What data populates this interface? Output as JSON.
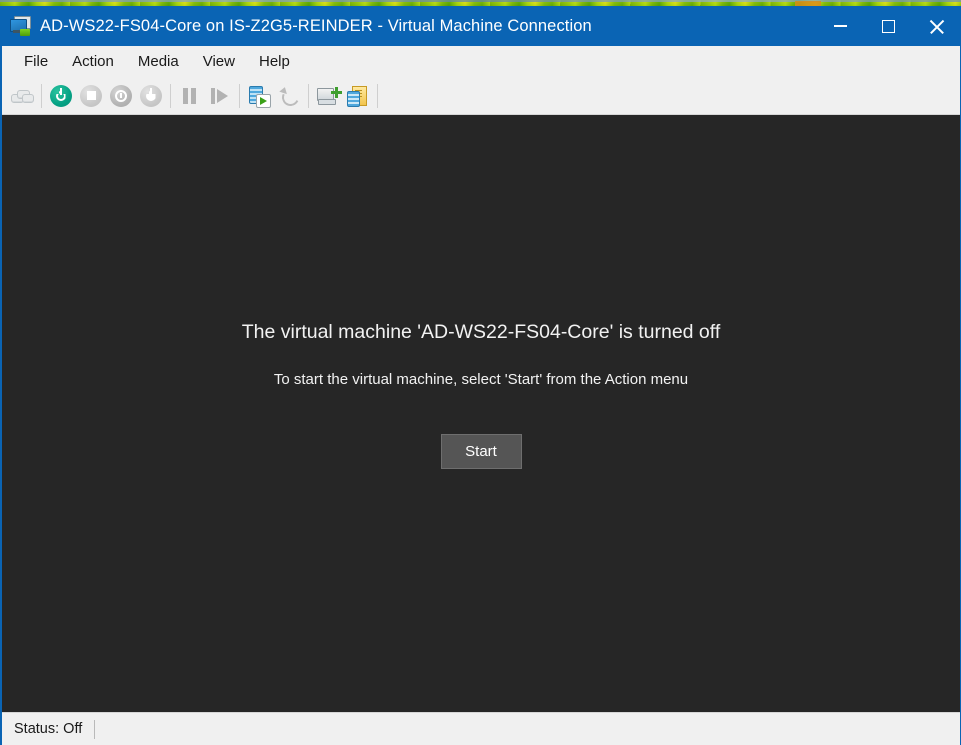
{
  "window": {
    "title": "AD-WS22-FS04-Core on IS-Z2G5-REINDER - Virtual Machine Connection",
    "icon": "virtual-machine-icon",
    "accent_color": "#0a64b4",
    "controls": {
      "minimize": "Minimize",
      "maximize": "Maximize",
      "close": "Close"
    }
  },
  "menubar": {
    "items": [
      {
        "label": "File"
      },
      {
        "label": "Action"
      },
      {
        "label": "Media"
      },
      {
        "label": "View"
      },
      {
        "label": "Help"
      }
    ]
  },
  "toolbar": {
    "buttons": [
      {
        "name": "ctrl-alt-delete-icon",
        "tooltip": "Ctrl+Alt+Delete",
        "enabled": false
      },
      {
        "name": "start-icon",
        "tooltip": "Start",
        "enabled": true,
        "color": "#06a184"
      },
      {
        "name": "turn-off-icon",
        "tooltip": "Turn Off",
        "enabled": false
      },
      {
        "name": "shut-down-icon",
        "tooltip": "Shut Down",
        "enabled": false
      },
      {
        "name": "save-icon",
        "tooltip": "Save",
        "enabled": false
      },
      {
        "name": "pause-icon",
        "tooltip": "Pause",
        "enabled": false
      },
      {
        "name": "resume-icon",
        "tooltip": "Resume",
        "enabled": false
      },
      {
        "name": "checkpoint-icon",
        "tooltip": "Checkpoint",
        "enabled": true
      },
      {
        "name": "revert-icon",
        "tooltip": "Revert",
        "enabled": false
      },
      {
        "name": "settings-icon",
        "tooltip": "Settings",
        "enabled": true
      },
      {
        "name": "enhanced-session-icon",
        "tooltip": "Enhanced Session",
        "enabled": true
      }
    ]
  },
  "viewport": {
    "background_color": "#262626",
    "primary_message": "The virtual machine 'AD-WS22-FS04-Core' is turned off",
    "secondary_message": "To start the virtual machine, select 'Start' from the Action menu",
    "start_button_label": "Start"
  },
  "statusbar": {
    "status_label": "Status: Off"
  }
}
